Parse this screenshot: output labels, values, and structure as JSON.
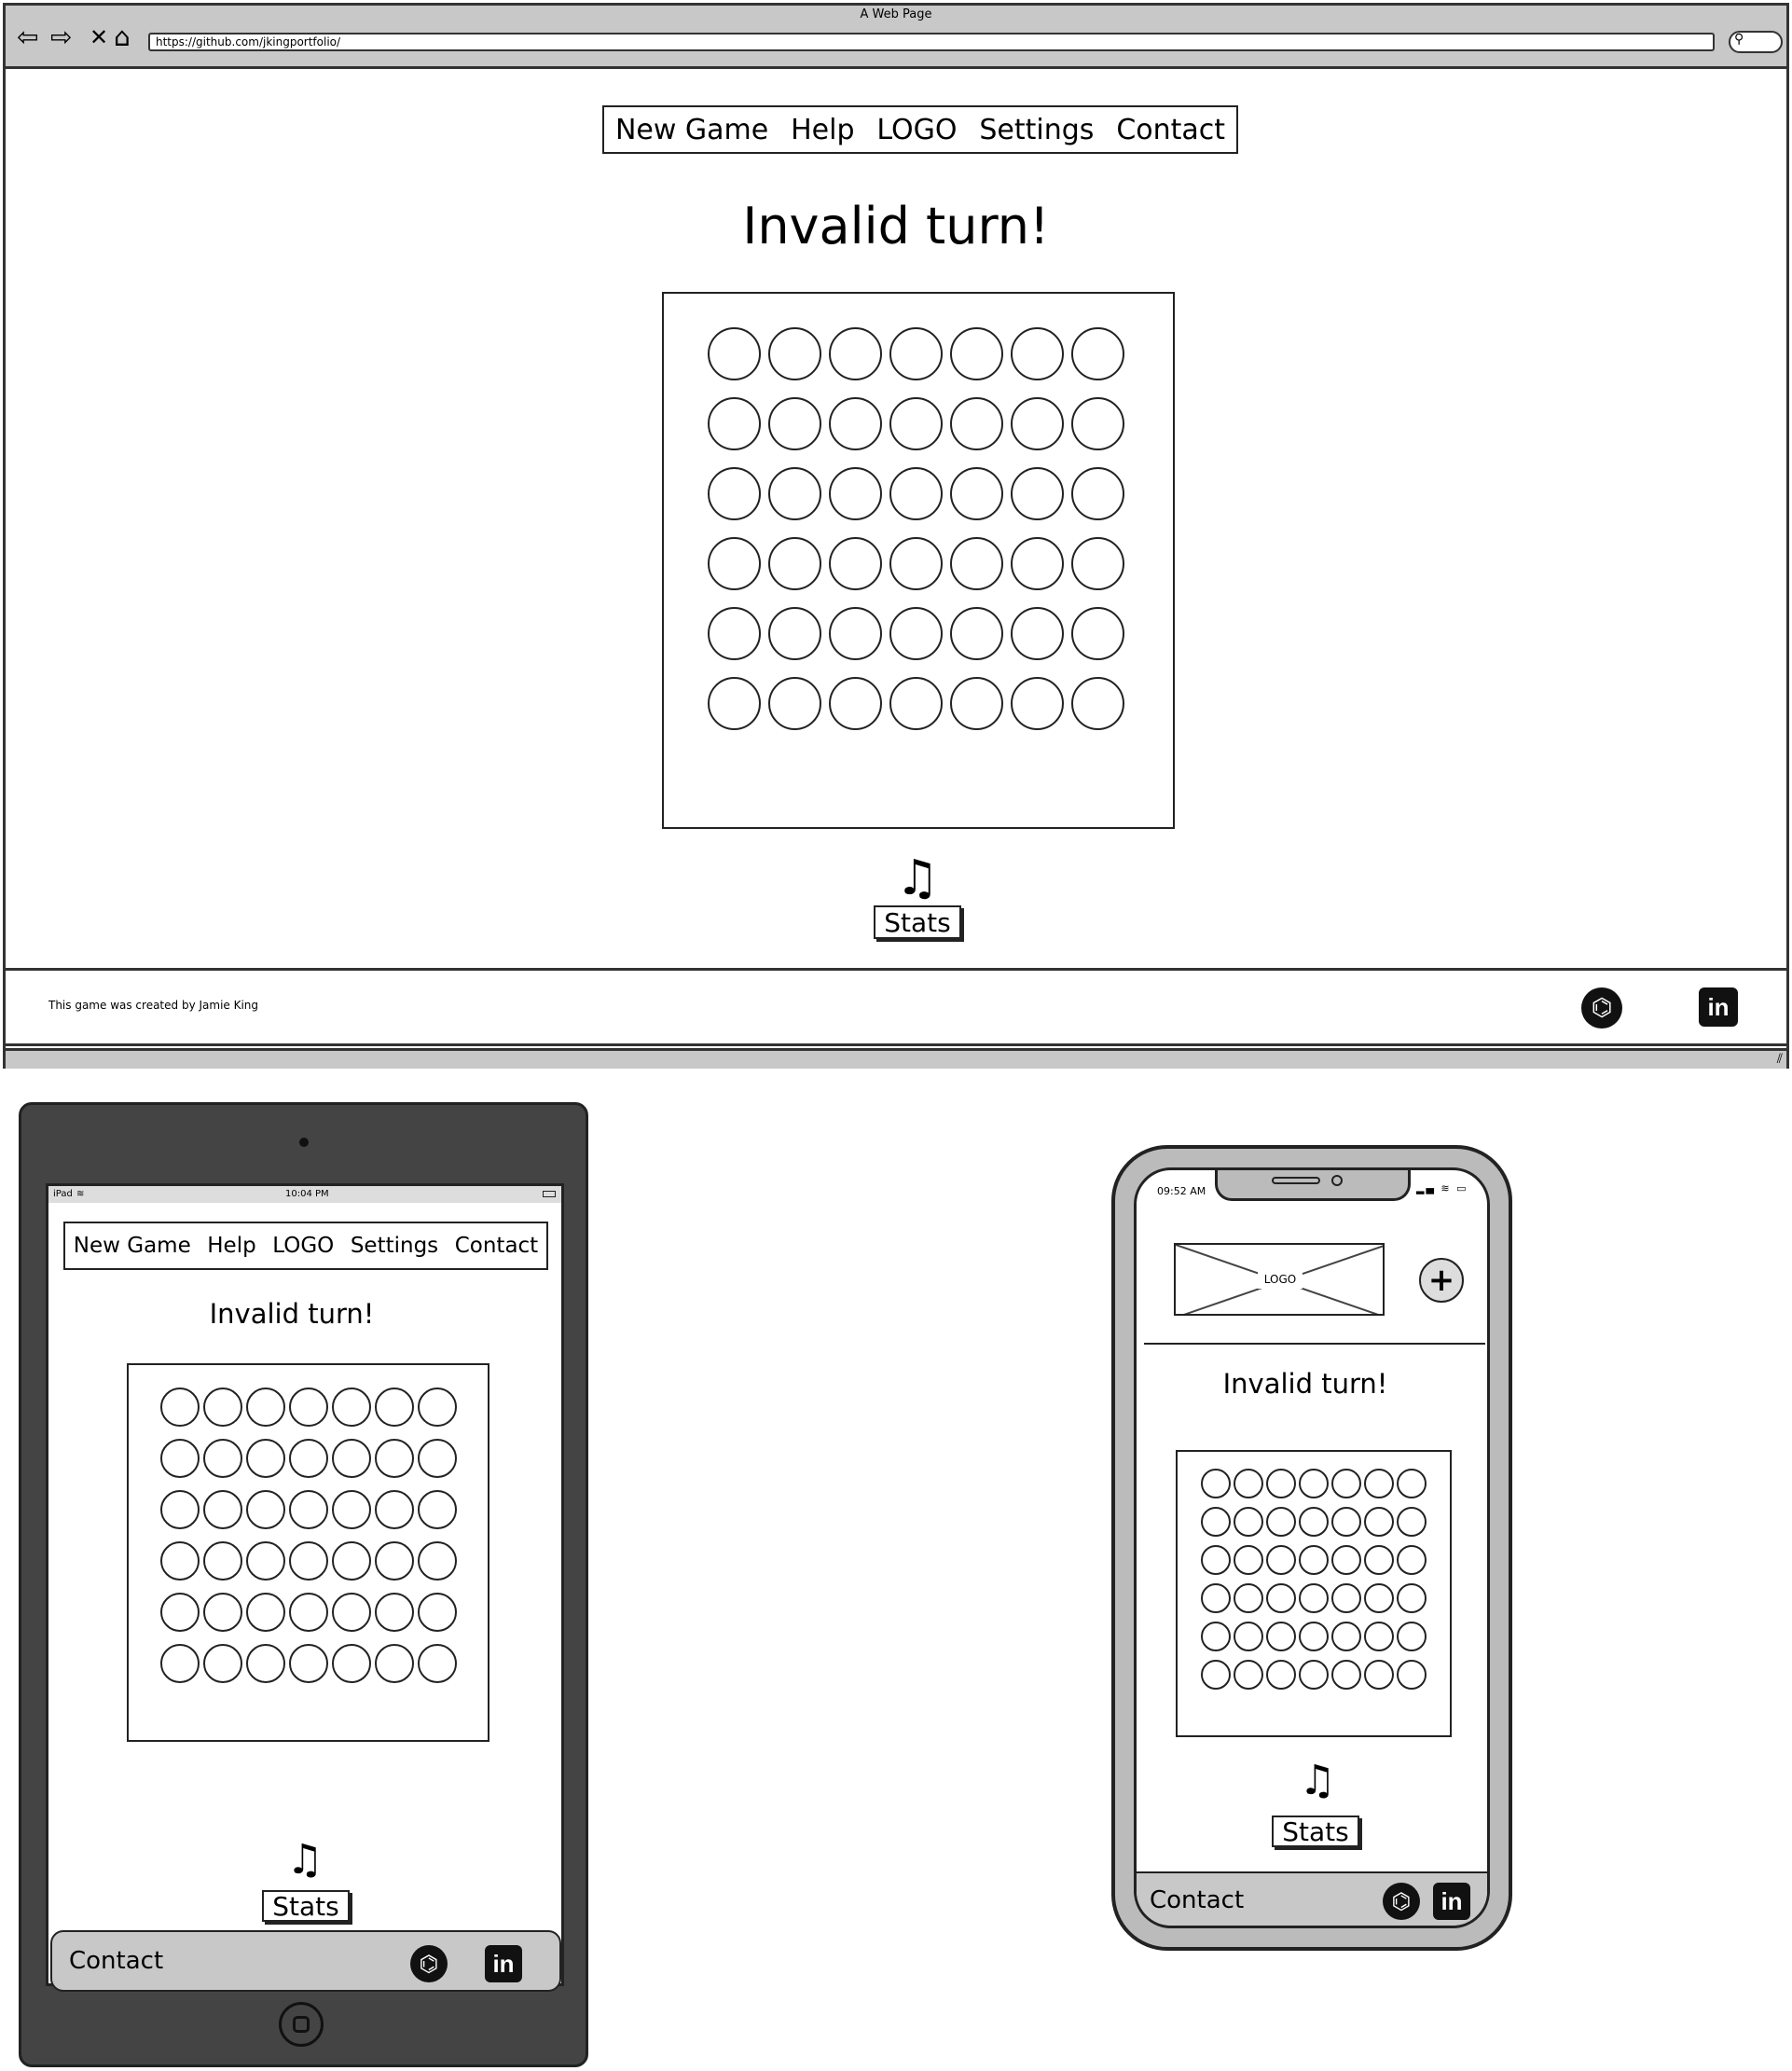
{
  "browser": {
    "window_title": "A Web Page",
    "url": "https://github.com/jkingportfolio/"
  },
  "nav": {
    "items": [
      "New Game",
      "Help",
      "LOGO",
      "Settings",
      "Contact"
    ]
  },
  "game": {
    "message": "Invalid turn!",
    "board": {
      "rows": 6,
      "columns": 7
    },
    "stats_label": "Stats",
    "music_icon": "music-note-icon"
  },
  "footer": {
    "credit": "This game was created by Jamie King",
    "contact_label": "Contact",
    "icons": [
      "github-icon",
      "linkedin-icon"
    ]
  },
  "tablet": {
    "status_device": "iPad",
    "status_time": "10:04 PM"
  },
  "phone": {
    "status_time": "09:52 AM",
    "logo_placeholder": "LOGO",
    "menu_icon": "plus-icon"
  }
}
